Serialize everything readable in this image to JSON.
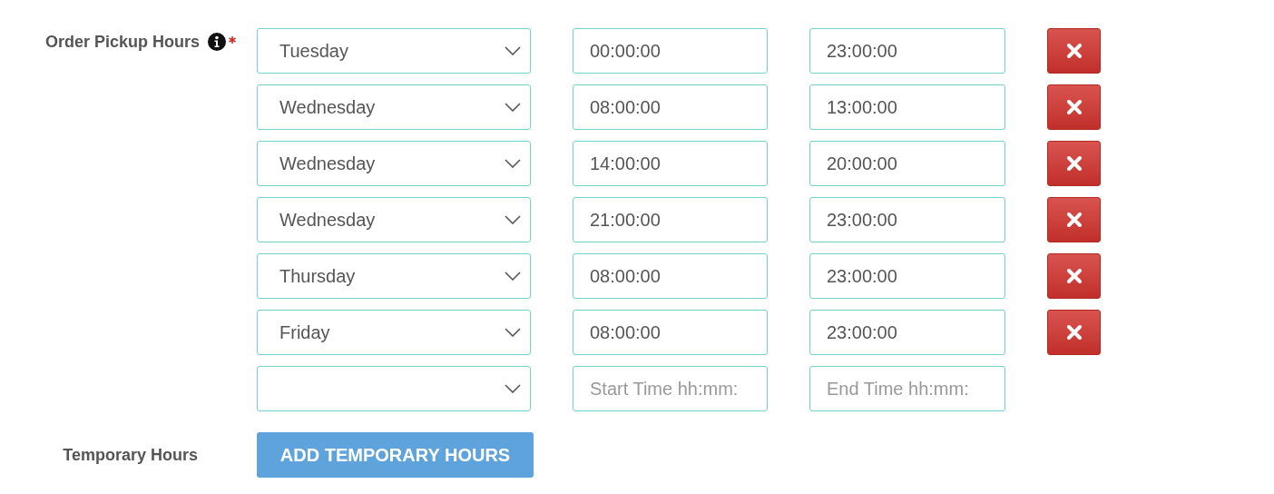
{
  "pickup_hours": {
    "label": "Order Pickup Hours",
    "required": true,
    "rows": [
      {
        "day": "Tuesday",
        "start": "00:00:00",
        "end": "23:00:00",
        "removable": true
      },
      {
        "day": "Wednesday",
        "start": "08:00:00",
        "end": "13:00:00",
        "removable": true
      },
      {
        "day": "Wednesday",
        "start": "14:00:00",
        "end": "20:00:00",
        "removable": true
      },
      {
        "day": "Wednesday",
        "start": "21:00:00",
        "end": "23:00:00",
        "removable": true
      },
      {
        "day": "Thursday",
        "start": "08:00:00",
        "end": "23:00:00",
        "removable": true
      },
      {
        "day": "Friday",
        "start": "08:00:00",
        "end": "23:00:00",
        "removable": true
      },
      {
        "start_placeholder": "Start Time hh:mm:",
        "end_placeholder": "End Time hh:mm:",
        "removable": false
      }
    ]
  },
  "temporary_hours": {
    "label": "Temporary Hours",
    "button": "ADD TEMPORARY HOURS"
  }
}
